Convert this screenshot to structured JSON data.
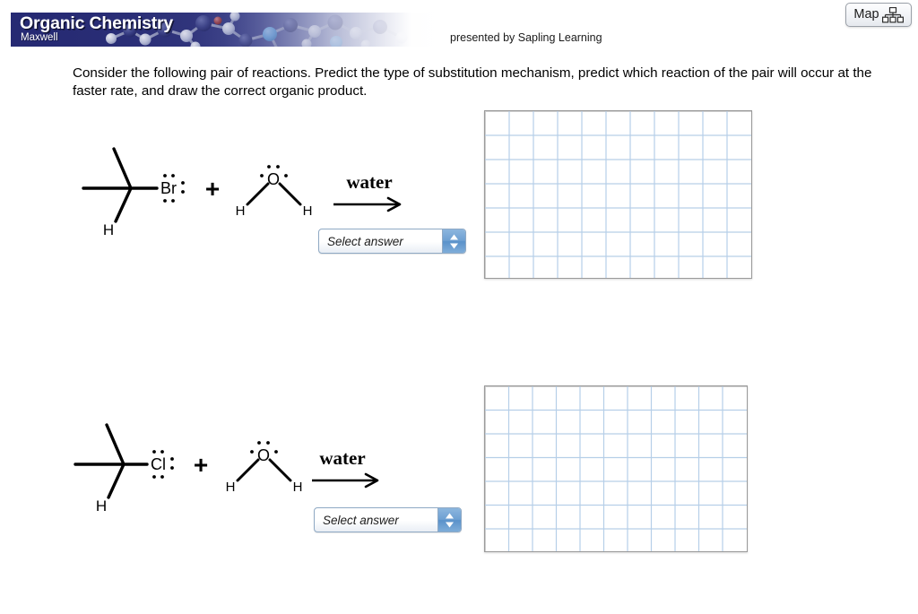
{
  "header": {
    "course_title": "Organic Chemistry",
    "author": "Maxwell",
    "presented_by": "presented by Sapling Learning",
    "map_button_label": "Map",
    "map_icon": "sitemap-icon",
    "banner_bg_color": "#262a73",
    "banner_image": "molecular-ball-and-stick-model"
  },
  "prompt": {
    "text": "Consider the following pair of reactions. Predict the type of substitution mechanism, predict which reaction of the pair will occur at the faster rate, and draw the correct organic product."
  },
  "reactions": [
    {
      "id": "reaction-1",
      "substrate": {
        "name": "tert-butyl-like-alkyl-halide",
        "central_atom": "C",
        "halogen_label": "Br",
        "hydrogen_label": "H",
        "halogen_lone_pairs": 3,
        "methyl_count": 2
      },
      "plus_sign": "+",
      "nucleophile": {
        "name": "water",
        "center_label": "O",
        "left_hydrogen": "H",
        "right_hydrogen": "H",
        "lone_pairs": 2
      },
      "arrow_label": "water",
      "answer_select": {
        "value": "Select answer",
        "placeholder": "Select answer"
      },
      "canvas": {
        "name": "molecule-drawing-canvas",
        "columns": 11,
        "rows": 7,
        "grid_color": "#b6cfe8"
      }
    },
    {
      "id": "reaction-2",
      "substrate": {
        "name": "tert-butyl-like-alkyl-halide",
        "central_atom": "C",
        "halogen_label": "Cl",
        "hydrogen_label": "H",
        "halogen_lone_pairs": 3,
        "methyl_count": 2
      },
      "plus_sign": "+",
      "nucleophile": {
        "name": "water",
        "center_label": "O",
        "left_hydrogen": "H",
        "right_hydrogen": "H",
        "lone_pairs": 2
      },
      "arrow_label": "water",
      "answer_select": {
        "value": "Select answer",
        "placeholder": "Select answer"
      },
      "canvas": {
        "name": "molecule-drawing-canvas",
        "columns": 11,
        "rows": 7,
        "grid_color": "#b6cfe8"
      }
    }
  ]
}
